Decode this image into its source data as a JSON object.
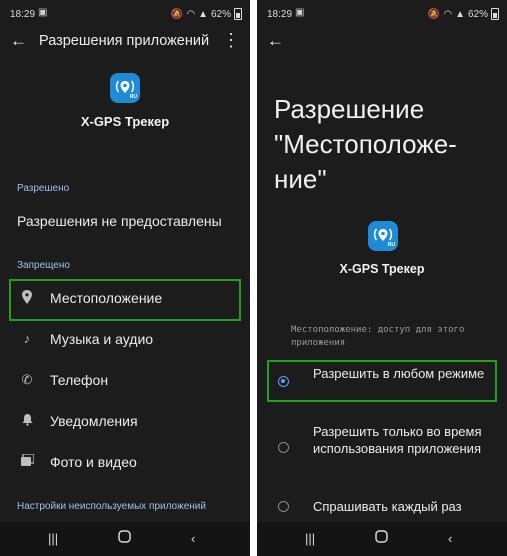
{
  "left_screen": {
    "status": {
      "time": "18:29",
      "battery": "62%"
    },
    "title": "Разрешения приложений",
    "app_name": "X-GPS Трекер",
    "app_icon_badge": "RU",
    "allowed_header": "Разрешено",
    "allowed_none": "Разрешения не предоставлены",
    "denied_header": "Запрещено",
    "denied_items": [
      {
        "label": "Местоположение",
        "icon": "location-pin-icon"
      },
      {
        "label": "Музыка и аудио",
        "icon": "music-note-icon"
      },
      {
        "label": "Телефон",
        "icon": "phone-icon"
      },
      {
        "label": "Уведомления",
        "icon": "bell-icon"
      },
      {
        "label": "Фото и видео",
        "icon": "photo-icon"
      }
    ],
    "unused_apps_header": "Настройки неиспользуемых приложений"
  },
  "right_screen": {
    "status": {
      "time": "18:29",
      "battery": "62%"
    },
    "title": "Разрешение \"Местоположе-ние\"",
    "title_lines": [
      "Разрешение",
      "\"Местоположе-",
      "ние\""
    ],
    "app_name": "X-GPS Трекер",
    "app_icon_badge": "RU",
    "caption": "Местоположение: доступ для этого приложения",
    "options": [
      {
        "label": "Разрешить в любом режиме",
        "selected": true
      },
      {
        "label": "Разрешить только во время использования приложения",
        "selected": false
      },
      {
        "label": "Спрашивать каждый раз",
        "selected": false
      }
    ]
  },
  "colors": {
    "highlight": "#22a022",
    "accent": "#5aa0f0",
    "app_icon": "#1f8ad6",
    "background": "#1c1c1c"
  }
}
